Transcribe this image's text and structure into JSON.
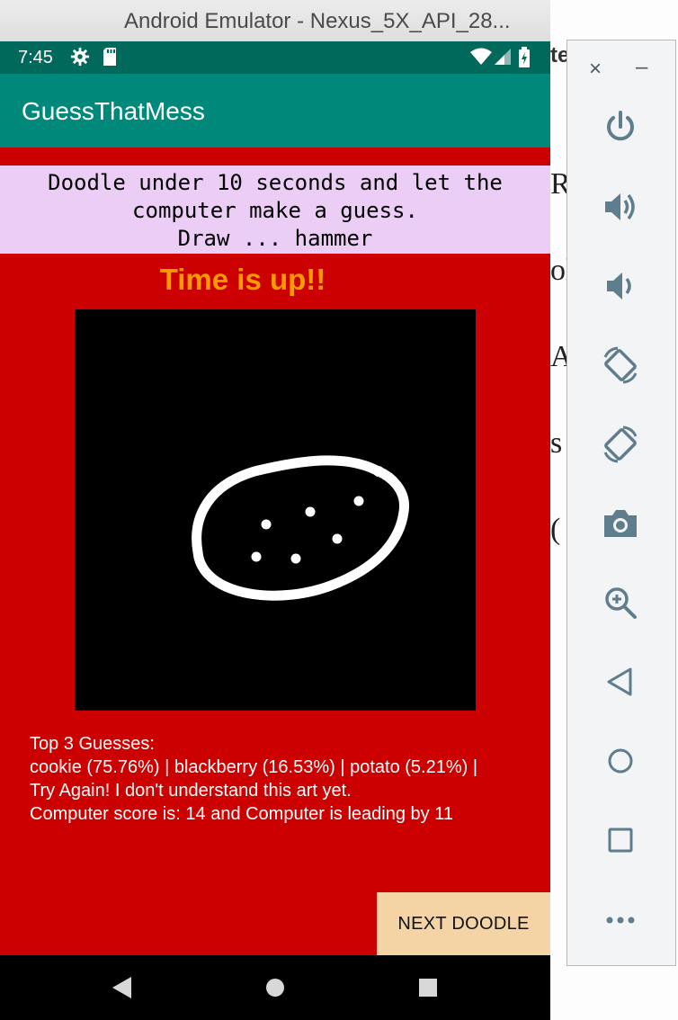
{
  "window": {
    "title": "Android Emulator - Nexus_5X_API_28..."
  },
  "status_bar": {
    "time": "7:45",
    "icons": [
      "settings-icon",
      "sd-card-icon",
      "wifi-icon",
      "signal-icon",
      "battery-icon"
    ]
  },
  "app_bar": {
    "title": "GuessThatMess"
  },
  "instructions": {
    "line1": "Doodle under 10 seconds and let the",
    "line2": "computer make a guess.",
    "line3": "Draw ... hammer"
  },
  "timer": {
    "message": "Time is up!!"
  },
  "results": {
    "header": "Top 3 Guesses:",
    "guesses_line": "cookie (75.76%) | blackberry (16.53%) | potato (5.21%) |",
    "feedback": "Try Again! I don't understand this art yet.",
    "score_line": "Computer score is: 14 and Computer is leading by 11"
  },
  "next_button": {
    "label": "NEXT DOODLE"
  },
  "nav_bar": {
    "icons": [
      "back-icon",
      "home-icon",
      "recents-icon"
    ]
  },
  "side_toolbar": {
    "close": "×",
    "minimize": "–",
    "tools": [
      "power-icon",
      "volume-up-icon",
      "volume-down-icon",
      "rotate-left-icon",
      "rotate-right-icon",
      "camera-icon",
      "zoom-icon",
      "back-icon",
      "home-icon",
      "overview-icon",
      "more-icon"
    ]
  },
  "background_window": {
    "fragments": [
      "te",
      "R",
      "ol",
      "A",
      "s",
      "("
    ]
  },
  "colors": {
    "status_bar": "#00695c",
    "app_bar": "#00897b",
    "content_bg": "#cc0000",
    "instruction_bg": "#eccdf5",
    "timer_text": "#ff9a00",
    "button_bg": "#f4d3a4"
  }
}
